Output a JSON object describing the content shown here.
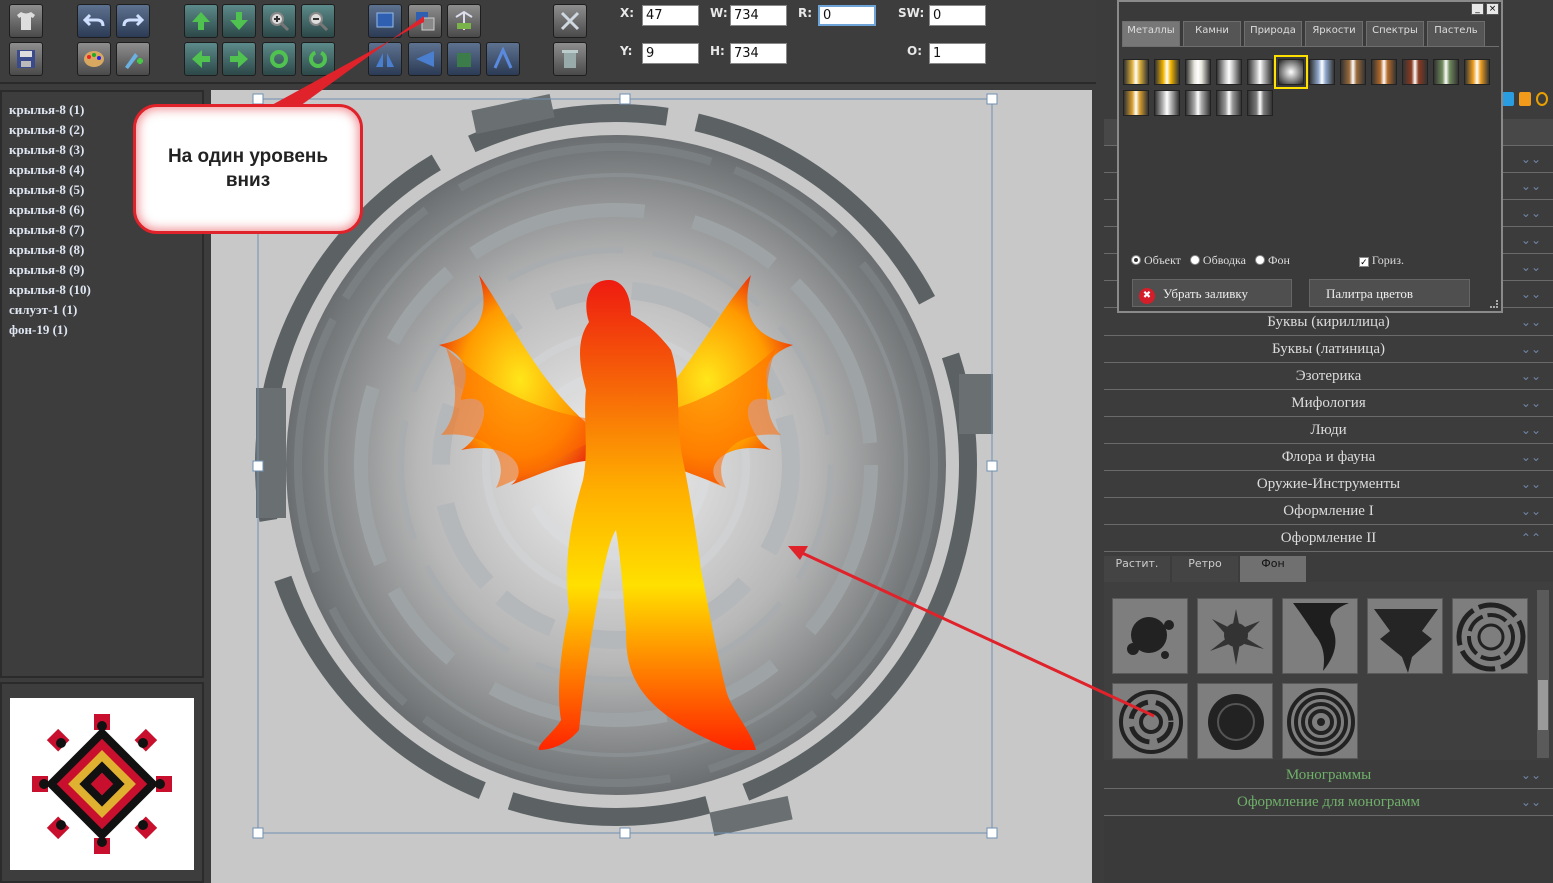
{
  "toolbar": {
    "x_label": "X:",
    "x_value": "47",
    "y_label": "Y:",
    "y_value": "9",
    "w_label": "W:",
    "w_value": "734",
    "h_label": "H:",
    "h_value": "734",
    "r_label": "R:",
    "r_value": "0",
    "sw_label": "SW:",
    "sw_value": "0",
    "o_label": "O:",
    "o_value": "1"
  },
  "layers": [
    "крылья-8 (1)",
    "крылья-8 (2)",
    "крылья-8 (3)",
    "крылья-8 (4)",
    "крылья-8 (5)",
    "крылья-8 (6)",
    "крылья-8 (7)",
    "крылья-8 (8)",
    "крылья-8 (9)",
    "крылья-8 (10)",
    "силуэт-1 (1)",
    "фон-19 (1)"
  ],
  "callout": {
    "text": "На один уровень вниз"
  },
  "fill_panel": {
    "tabs": [
      "Металлы",
      "Камни",
      "Природа",
      "Яркости",
      "Спектры",
      "Пастель"
    ],
    "active_tab": "Металлы",
    "target_options": [
      "Объект",
      "Обводка",
      "Фон"
    ],
    "selected_target": "Объект",
    "horizontal_label": "Гориз.",
    "horizontal_checked": true,
    "remove_fill_label": "Убрать заливку",
    "palette_label": "Палитра цветов",
    "swatches_row1": [
      "#e2b33c",
      "#f5b800",
      "#e8e6dc",
      "#c9c9c9",
      "#b8b8b8",
      "#9a9a9a",
      "#8fa9cf",
      "#9a6a3a",
      "#b46a2a",
      "#8a3a20",
      "#6f8a5c",
      "#f0a020"
    ],
    "swatches_row2": [
      "#d9a030",
      "#bdbdbd",
      "#a8a8a8",
      "#999999",
      "#7a7a7a"
    ]
  },
  "library": {
    "categories": [
      "Буквы (кириллица)",
      "Буквы (латиница)",
      "Эзотерика",
      "Мифология",
      "Люди",
      "Флора и фауна",
      "Оружие-Инструменты",
      "Оформление I",
      "Оформление II"
    ],
    "subtabs": [
      "Растит.",
      "Ретро",
      "Фон"
    ],
    "active_subtab": "Фон",
    "bottom_categories": [
      "Монограммы",
      "Оформление для монограмм"
    ]
  },
  "colors": {
    "annotation_red": "#e0222a",
    "selection_blue": "#6f8fb0",
    "accent_green": "#6fb06a"
  }
}
